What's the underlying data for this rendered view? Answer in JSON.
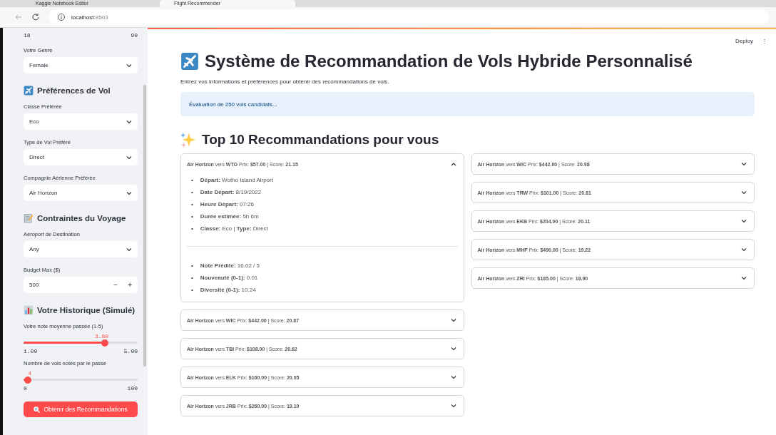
{
  "browser": {
    "tabs": [
      {
        "title": "Kaggle Notebook Editor",
        "selected": false
      },
      {
        "title": "Flight Recommender",
        "selected": true
      }
    ],
    "url_host": "localhost",
    "url_port": ":8503"
  },
  "sidebar": {
    "items": [
      {
        "kind": "range_labels",
        "min": "18",
        "max": "90"
      },
      {
        "kind": "select",
        "label": "Votre Genre",
        "value": "Female"
      },
      {
        "kind": "heading",
        "text": "Préférences de Vol"
      },
      {
        "kind": "select",
        "label": "Classe Préférée",
        "value": "Eco"
      },
      {
        "kind": "select",
        "label": "Type de Vol Préféré",
        "value": "Direct"
      },
      {
        "kind": "select",
        "label": "Compagnie Aérienne Préférée",
        "value": "Air Horizon"
      },
      {
        "kind": "heading",
        "text": "Contraintes du Voyage"
      },
      {
        "kind": "select",
        "label": "Aéroport de Destination",
        "value": "Any"
      },
      {
        "kind": "number",
        "label": "Budget Max ($)",
        "value": "500",
        "minus": "−",
        "plus": "+"
      },
      {
        "kind": "heading",
        "text": "Votre Historique (Simulé)"
      },
      {
        "kind": "slider",
        "label": "Votre note moyenne passée (1-5)",
        "value": "3.80",
        "min": "1.00",
        "max": "5.00",
        "level": 0.71
      },
      {
        "kind": "slider",
        "label": "Nombre de vols notés par le passé",
        "value": "4",
        "min": "0",
        "max": "100",
        "level": 0.04
      },
      {
        "kind": "button",
        "text": "Obtenir des Recommandations"
      }
    ]
  },
  "header": {
    "deploy": "Deploy",
    "menu": "⋮"
  },
  "title": "Système de Recommandation de Vols Hybride Personnalisé",
  "subtitle": "Entrez vos informations et préférences pour obtenir des recommandations de vols.",
  "info": "Évaluation de 250 vols candidats...",
  "section": "Top 10 Recommandations pour vous",
  "bullet": "•",
  "columns": [
    [
      {
        "header": "**Air Horizon** vers **WTO** Prix: **$57.00** | Score: **21.15**",
        "expanded": true,
        "details": [
          "**Départ:** Wotho Island Airport",
          "**Date Départ:** 8/19/2022",
          "**Heure Départ:** 07:26",
          "**Durée estimée:** 5h 6m",
          "**Classe:** Eco | **Type:** Direct"
        ],
        "metrics": [
          "**Note Prédite:** 16.02 / 5",
          "**Nouveauté (0-1):** 0.01",
          "**Diversité (0-1):** 10.24"
        ]
      },
      {
        "header": "**Air Horizon** vers **WIC** Prix: **$442.00** | Score: **20.87**",
        "expanded": false
      },
      {
        "header": "**Air Horizon** vers **TBI** Prix: **$108.00** | Score: **20.62**",
        "expanded": false
      },
      {
        "header": "**Air Horizon** vers **ELK** Prix: **$160.00** | Score: **20.05**",
        "expanded": false
      },
      {
        "header": "**Air Horizon** vers **JRB** Prix: **$260.00** | Score: **19.10**",
        "expanded": false
      }
    ],
    [
      {
        "header": "**Air Horizon** vers **WIC** Prix: **$442.00** | Score: **20.98**",
        "expanded": false
      },
      {
        "header": "**Air Horizon** vers **TRW** Prix: **$101.00** | Score: **20.81**",
        "expanded": false
      },
      {
        "header": "**Air Horizon** vers **EKB** Prix: **$204.00** | Score: **20.11**",
        "expanded": false
      },
      {
        "header": "**Air Horizon** vers **MHF** Prix: **$490.00** | Score: **19.22**",
        "expanded": false
      },
      {
        "header": "**Air Horizon** vers **ZRI** Prix: **$185.00** | Score: **18.90**",
        "expanded": false
      }
    ]
  ]
}
